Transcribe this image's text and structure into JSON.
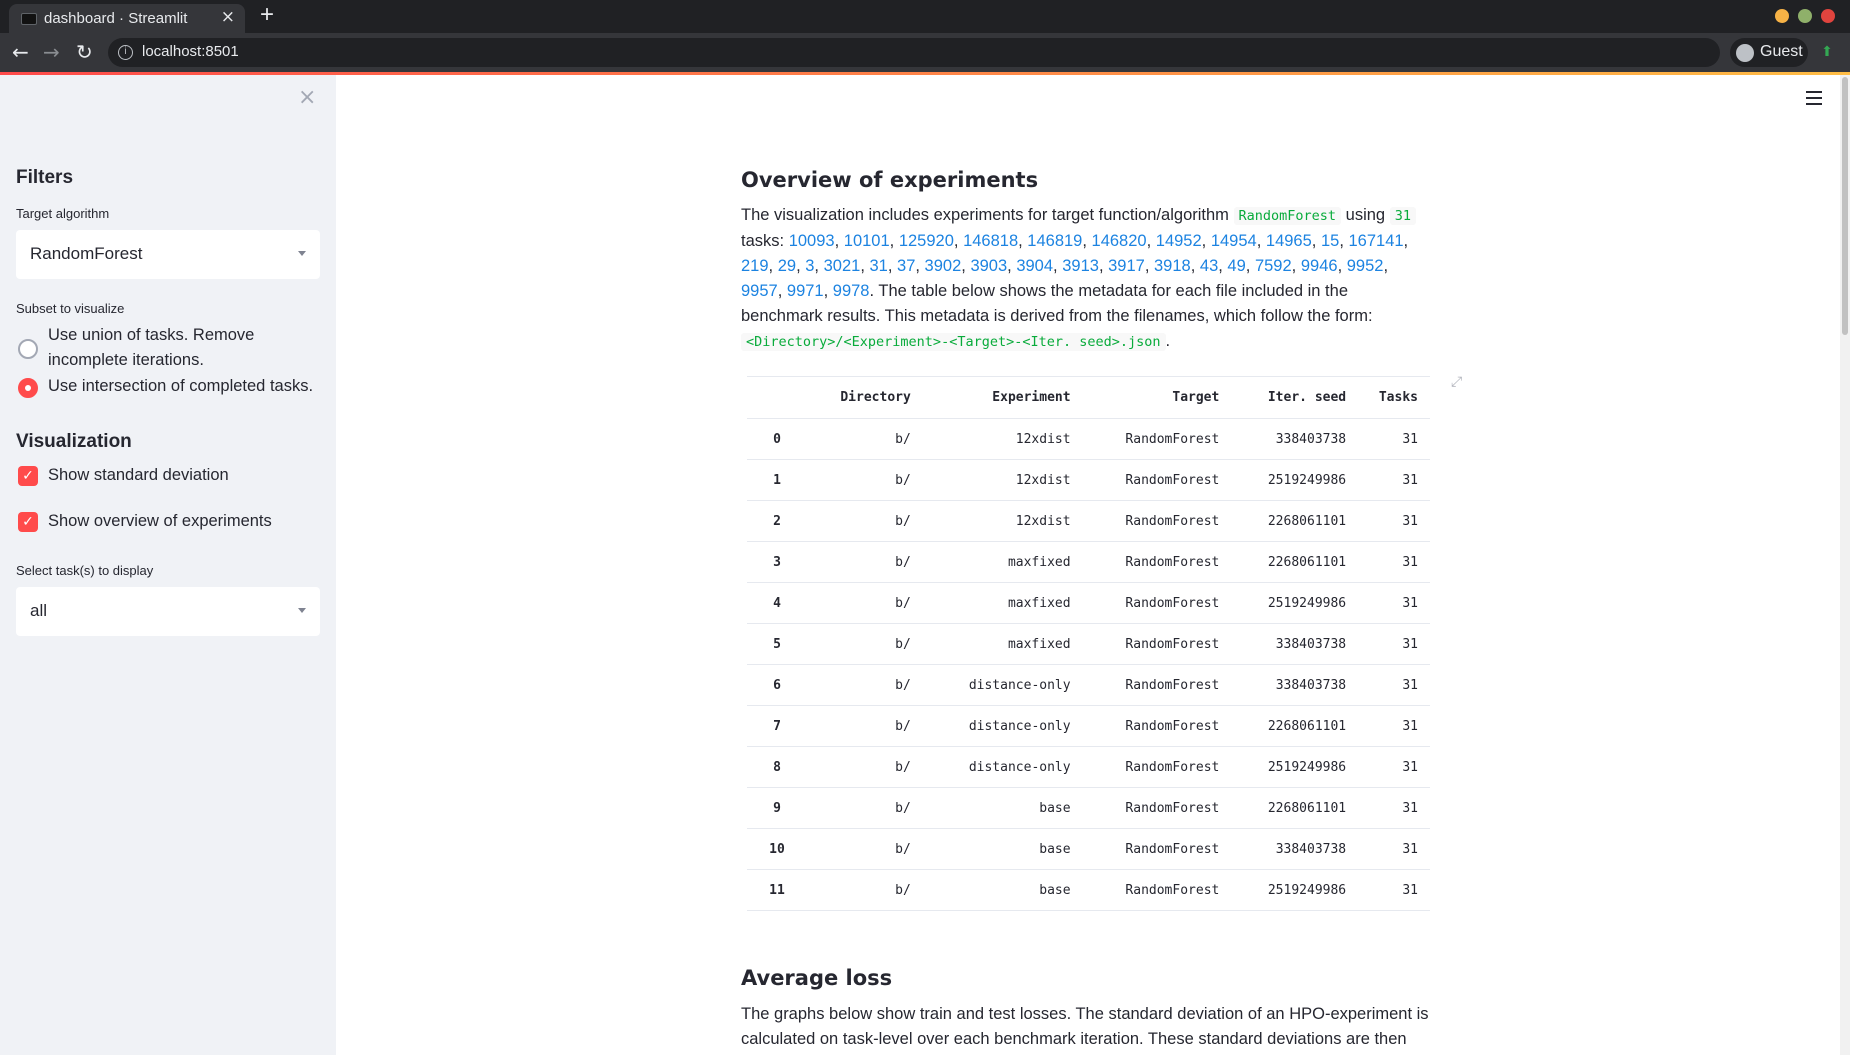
{
  "browser": {
    "tab_title": "dashboard · Streamlit",
    "tab_close": "×",
    "new_tab": "+",
    "url": "localhost:8501",
    "profile": "Guest",
    "window_colors": [
      "#f6b246",
      "#8fb06a",
      "#e0443e"
    ]
  },
  "sidebar": {
    "close": "×",
    "filters_heading": "Filters",
    "target_label": "Target algorithm",
    "target_value": "RandomForest",
    "subset_label": "Subset to visualize",
    "subset_options": [
      {
        "label": "Use union of tasks. Remove incomplete iterations.",
        "checked": false
      },
      {
        "label": "Use intersection of completed tasks.",
        "checked": true
      }
    ],
    "viz_heading": "Visualization",
    "checkboxes": [
      {
        "label": "Show standard deviation",
        "checked": true
      },
      {
        "label": "Show overview of experiments",
        "checked": true
      }
    ],
    "tasks_label": "Select task(s) to display",
    "tasks_value": "all"
  },
  "main": {
    "overview_heading": "Overview of experiments",
    "intro_text": "The visualization includes experiments for target function/algorithm",
    "target_code": "RandomForest",
    "using_text": "using",
    "task_count": "31",
    "tasks_text": "tasks:",
    "task_ids": [
      "10093",
      "10101",
      "125920",
      "146818",
      "146819",
      "146820",
      "14952",
      "14954",
      "14965",
      "15",
      "167141",
      "219",
      "29",
      "3",
      "3021",
      "31",
      "37",
      "3902",
      "3903",
      "3904",
      "3913",
      "3917",
      "3918",
      "43",
      "49",
      "7592",
      "9946",
      "9952",
      "9957",
      "9971",
      "9978"
    ],
    "after_tasks_text": ". The table below shows the metadata for each file included in the benchmark results. This metadata is derived from the filenames, which follow the form:",
    "filename_form": "<Directory>/<Experiment>-<Target>-<Iter. seed>.json",
    "period": ".",
    "table": {
      "columns": [
        "",
        "Directory",
        "Experiment",
        "Target",
        "Iter. seed",
        "Tasks"
      ],
      "rows": [
        [
          "0",
          "b/",
          "12xdist",
          "RandomForest",
          "338403738",
          "31"
        ],
        [
          "1",
          "b/",
          "12xdist",
          "RandomForest",
          "2519249986",
          "31"
        ],
        [
          "2",
          "b/",
          "12xdist",
          "RandomForest",
          "2268061101",
          "31"
        ],
        [
          "3",
          "b/",
          "maxfixed",
          "RandomForest",
          "2268061101",
          "31"
        ],
        [
          "4",
          "b/",
          "maxfixed",
          "RandomForest",
          "2519249986",
          "31"
        ],
        [
          "5",
          "b/",
          "maxfixed",
          "RandomForest",
          "338403738",
          "31"
        ],
        [
          "6",
          "b/",
          "distance-only",
          "RandomForest",
          "338403738",
          "31"
        ],
        [
          "7",
          "b/",
          "distance-only",
          "RandomForest",
          "2268061101",
          "31"
        ],
        [
          "8",
          "b/",
          "distance-only",
          "RandomForest",
          "2519249986",
          "31"
        ],
        [
          "9",
          "b/",
          "base",
          "RandomForest",
          "2268061101",
          "31"
        ],
        [
          "10",
          "b/",
          "base",
          "RandomForest",
          "338403738",
          "31"
        ],
        [
          "11",
          "b/",
          "base",
          "RandomForest",
          "2519249986",
          "31"
        ]
      ]
    },
    "loss_heading": "Average loss",
    "loss_text": "The graphs below show train and test losses. The standard deviation of an HPO-experiment is calculated on task-level over each benchmark iteration. These standard deviations are then"
  }
}
